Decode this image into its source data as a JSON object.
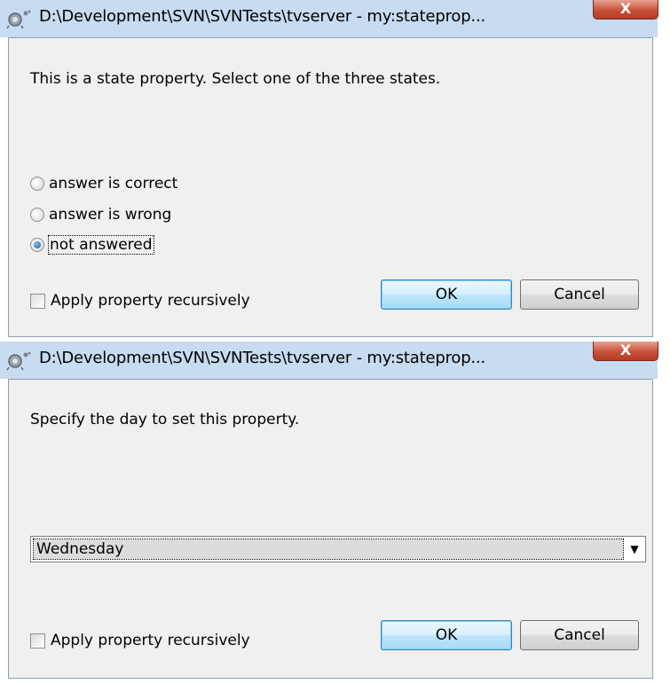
{
  "dialog1": {
    "title": "D:\\Development\\SVN\\SVNTests\\tvserver - my:stateprop...",
    "close_label": "X",
    "prompt": "This is a state property. Select one of the three states.",
    "options": [
      {
        "label": "answer is correct",
        "selected": false
      },
      {
        "label": "answer is wrong",
        "selected": false
      },
      {
        "label": "not answered",
        "selected": true
      }
    ],
    "recursive_label": "Apply property recursively",
    "recursive_checked": false,
    "ok_label": "OK",
    "cancel_label": "Cancel"
  },
  "dialog2": {
    "title": "D:\\Development\\SVN\\SVNTests\\tvserver - my:stateprop...",
    "close_label": "X",
    "prompt": "Specify the day to set this property.",
    "day_value": "Wednesday",
    "recursive_label": "Apply property recursively",
    "recursive_checked": false,
    "ok_label": "OK",
    "cancel_label": "Cancel"
  },
  "colors": {
    "titlebar": "#c7dbf1",
    "client_bg": "#f0f0f0",
    "close_button": "#c7513a",
    "default_button_border": "#3c7fb1"
  },
  "icons": {
    "title_icon": "tortoisesvn-properties-icon",
    "dropdown": "chevron-down-icon"
  }
}
